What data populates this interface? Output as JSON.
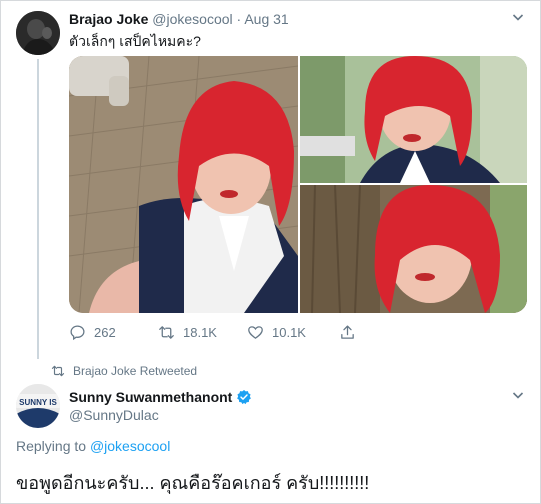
{
  "tweet1": {
    "name": "Brajao Joke",
    "handle": "@jokesocool",
    "separator": "·",
    "date": "Aug 31",
    "text": "ตัวเล็กๆ เสป็คไหมคะ?",
    "media": [
      {
        "alt": "Person in red bob wig and school uniform sitting on brick pavement"
      },
      {
        "alt": "Close-up selfie in red bob wig outdoors"
      },
      {
        "alt": "Selfie in red bob wig leaning against a tree"
      }
    ],
    "actions": {
      "replies": "262",
      "retweets": "18.1K",
      "likes": "10.1K"
    }
  },
  "retweet_banner": {
    "text": "Brajao Joke Retweeted"
  },
  "tweet2": {
    "name": "Sunny Suwanmethanont",
    "handle": "@SunnyDulac",
    "avatar_text": "SUNNY IS",
    "replying_prefix": "Replying to",
    "replying_to": "@jokesocool",
    "text": "ขอพูดอีกนะครับ... คุณคือร๊อคเกอร์ ครับ!!!!!!!!!!"
  },
  "colors": {
    "accent": "#1da1f2",
    "muted": "#657786",
    "text": "#14171a",
    "wig_red": "#d8252f"
  },
  "icons": [
    "chevron-down-icon",
    "reply-icon",
    "retweet-icon",
    "like-icon",
    "share-icon",
    "verified-badge-icon"
  ]
}
